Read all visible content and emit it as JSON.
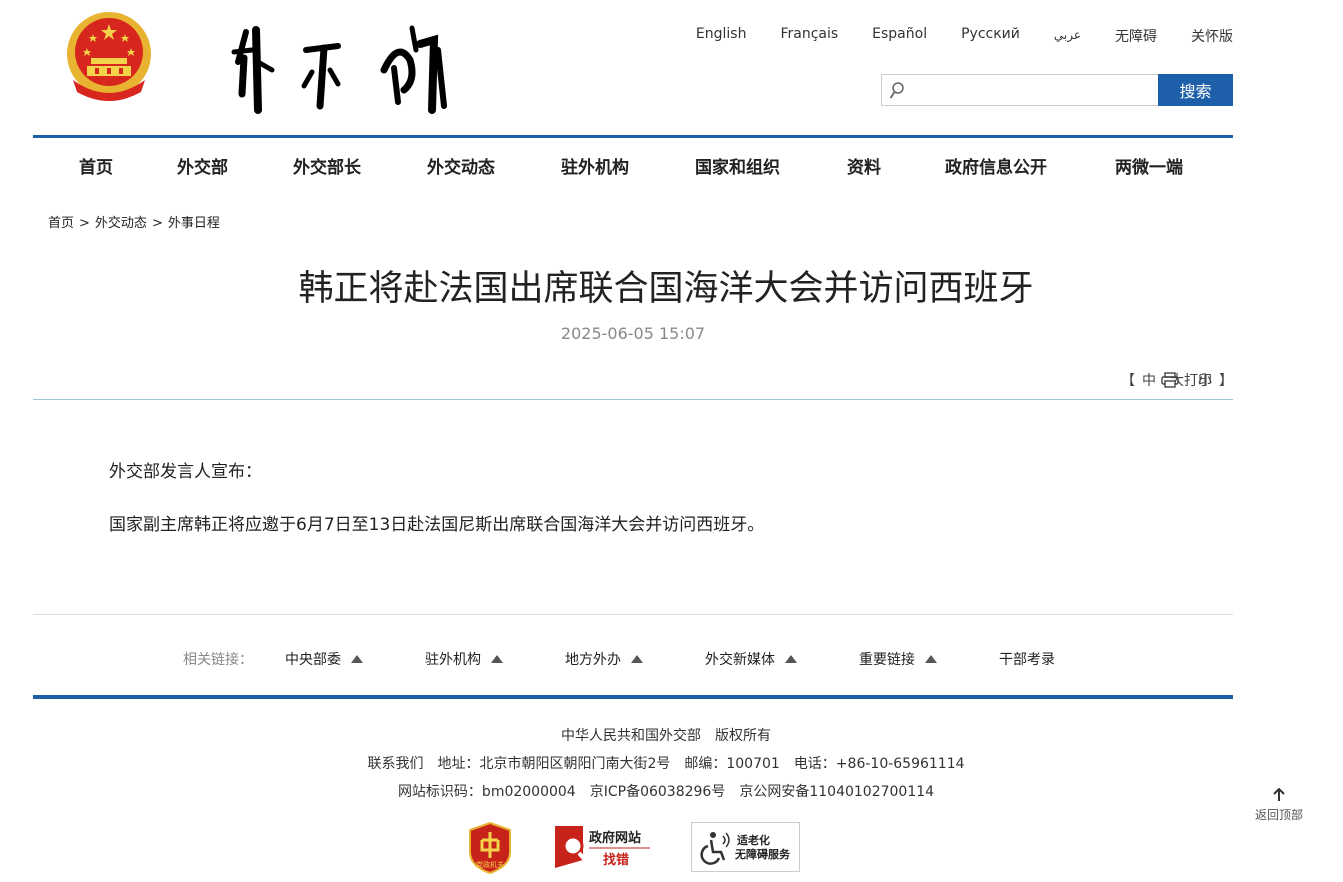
{
  "languages": [
    "English",
    "Français",
    "Español",
    "Русский",
    "عربي",
    "无障碍",
    "关怀版"
  ],
  "search": {
    "placeholder": "",
    "button_label": "搜索"
  },
  "nav": [
    "首页",
    "外交部",
    "外交部长",
    "外交动态",
    "驻外机构",
    "国家和组织",
    "资料",
    "政府信息公开",
    "两微一端"
  ],
  "breadcrumb": [
    "首页",
    "外交动态",
    "外事日程"
  ],
  "article": {
    "title": "韩正将赴法国出席联合国海洋大会并访问西班牙",
    "date": "2025-06-05 15:07",
    "paragraphs": [
      "外交部发言人宣布：",
      "国家副主席韩正将应邀于6月7日至13日赴法国尼斯出席联合国海洋大会并访问西班牙。"
    ]
  },
  "font_size": {
    "open": "【",
    "options": [
      "中",
      "大",
      "小"
    ],
    "close": "】"
  },
  "print_label": "打印",
  "related": {
    "label": "相关链接：",
    "items": [
      "中央部委",
      "驻外机构",
      "地方外办",
      "外交新媒体",
      "重要链接",
      "干部考录"
    ]
  },
  "footer": {
    "line1": "中华人民共和国外交部　版权所有",
    "line2": [
      "联系我们",
      "地址：北京市朝阳区朝阳门南大街2号",
      "邮编：100701",
      "电话：+86-10-65961114"
    ],
    "line3": [
      "网站标识码：bm02000004",
      "京ICP备06038296号",
      "京公网安备11040102700114"
    ]
  },
  "badges": {
    "party": "党政机关",
    "gov_error_top": "政府网站",
    "gov_error_bottom": "找错",
    "elderly_top": "适老化",
    "elderly_bottom": "无障碍服务"
  },
  "back_to_top": "返回顶部",
  "colors": {
    "brand_blue": "#1d5fa8",
    "emblem_red": "#d7261e",
    "emblem_gold": "#e8b330"
  }
}
